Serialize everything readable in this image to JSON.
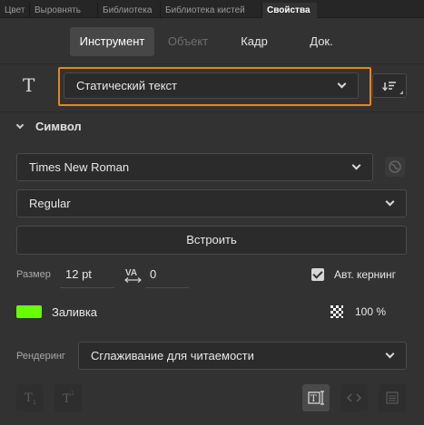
{
  "tabs": [
    {
      "label": "Цвет"
    },
    {
      "label": "Выровнять"
    },
    {
      "label": "Библиотека"
    },
    {
      "label": "Библиотека кистей"
    },
    {
      "label": "Свойства"
    }
  ],
  "mode_tabs": {
    "instrument": "Инструмент",
    "object": "Объект",
    "frame": "Кадр",
    "doc": "Док."
  },
  "text_type": {
    "value": "Статический текст"
  },
  "symbol": {
    "title": "Символ",
    "font_family": "Times New Roman",
    "font_style": "Regular",
    "embed_button": "Встроить",
    "size_label": "Размер",
    "size_value": "12 pt",
    "tracking_value": "0",
    "auto_kern_label": "Авт. кернинг",
    "auto_kern_checked": true,
    "fill_label": "Заливка",
    "fill_color": "#66ff00",
    "opacity_value": "100 %",
    "render_label": "Рендеринг",
    "render_value": "Сглаживание для читаемости"
  },
  "icons": {
    "text_tool": "text-tool-icon",
    "sort": "sort-lines-icon",
    "globe": "globe-icon",
    "tracking": "letter-spacing-icon",
    "opacity": "checkerboard-icon",
    "subscript": "subscript-icon",
    "superscript": "superscript-icon",
    "selectable": "selectable-text-icon",
    "html": "html-tag-icon",
    "border": "text-border-icon"
  },
  "colors": {
    "accent": "#e8851d",
    "panel": "#323232"
  }
}
